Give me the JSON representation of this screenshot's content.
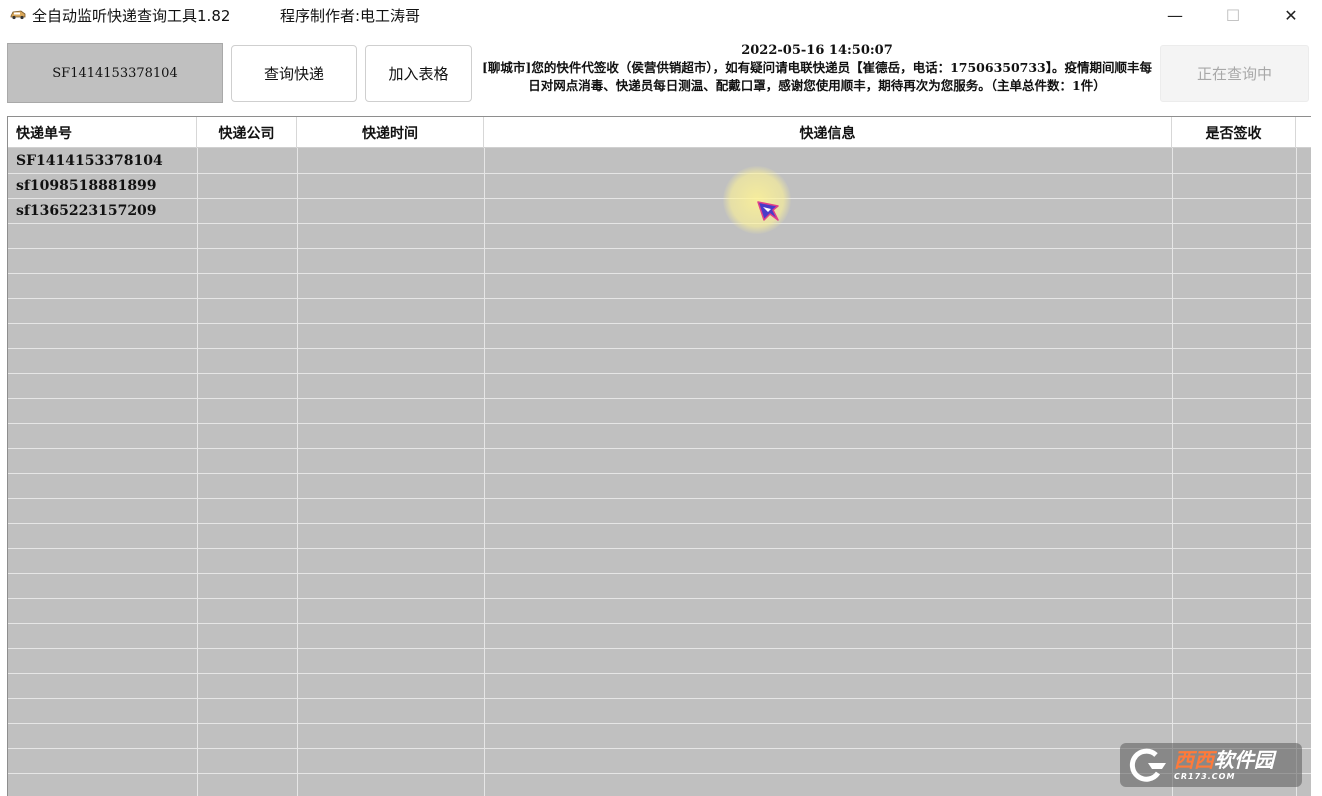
{
  "window": {
    "title": "全自动监听快递查询工具1.82",
    "author": "程序制作者:电工涛哥",
    "minimize_symbol": "—",
    "maximize_symbol": "☐",
    "close_symbol": "✕"
  },
  "toolbar": {
    "tracking_number": "SF1414153378104",
    "query_button": "查询快递",
    "add_button": "加入表格",
    "status_button": "正在查询中"
  },
  "info": {
    "timestamp": "2022-05-16 14:50:07",
    "message": "[聊城市]您的快件代签收（侯营供销超市），如有疑问请电联快递员【崔德岳，电话：17506350733】。疫情期间顺丰每日对网点消毒、快递员每日测温、配戴口罩，感谢您使用顺丰，期待再次为您服务。（主单总件数：1件）"
  },
  "table": {
    "columns": [
      "快递单号",
      "快递公司",
      "快递时间",
      "快递信息",
      "是否签收"
    ],
    "rows": [
      [
        "SF1414153378104",
        "",
        "",
        "",
        ""
      ],
      [
        "sf1098518881899",
        "",
        "",
        "",
        ""
      ],
      [
        "sf1365223157209",
        "",
        "",
        "",
        ""
      ]
    ]
  },
  "icons": {
    "app": "car-icon",
    "cursor": "mouse-pointer-icon"
  },
  "watermark": {
    "brand": "西西",
    "suffix": "软件园",
    "domain": "CR173.COM"
  }
}
